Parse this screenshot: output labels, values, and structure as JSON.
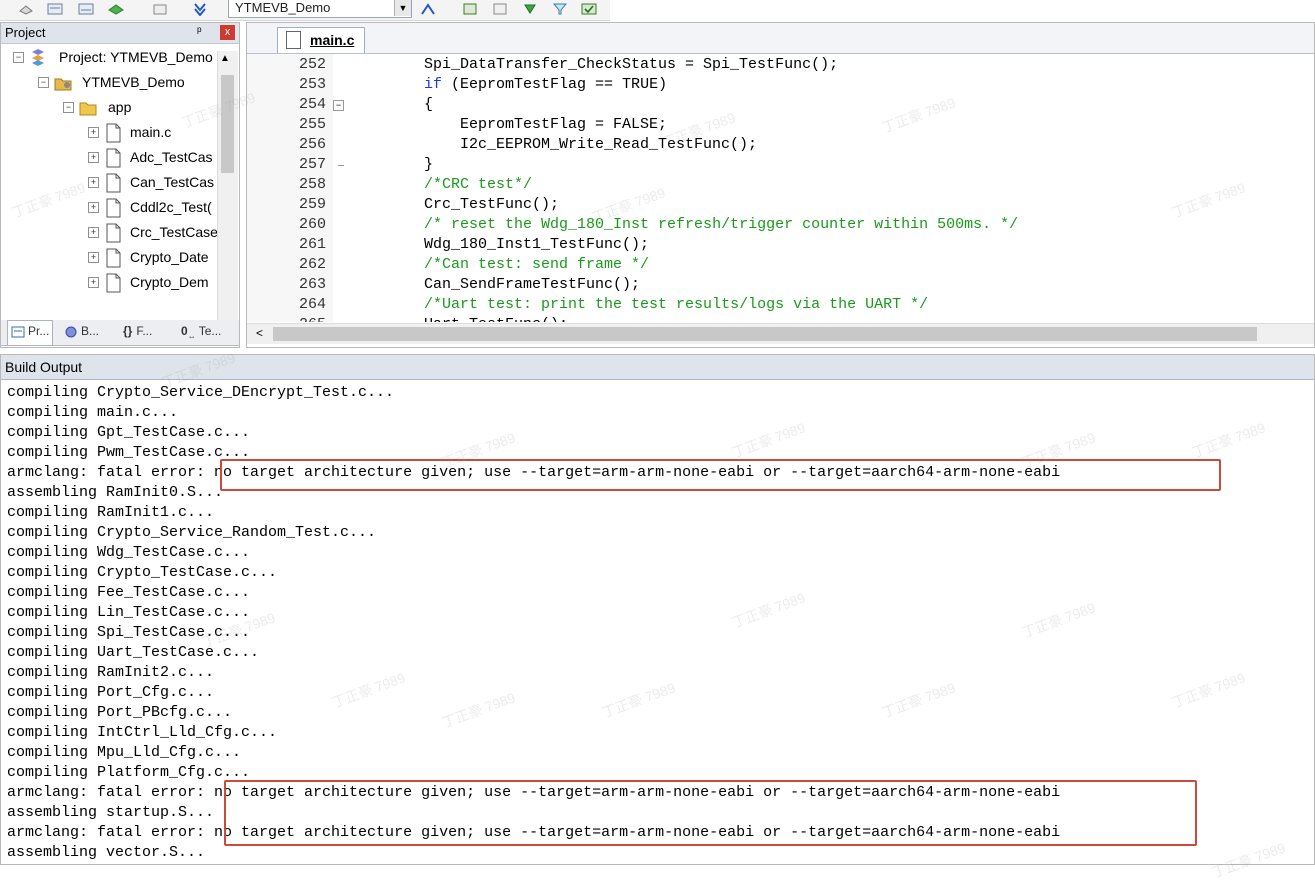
{
  "toolbar": {
    "target_value": "YTMEVB_Demo"
  },
  "project_panel": {
    "title": "Project",
    "pin_glyph": "ᵖ",
    "close_glyph": "x",
    "tree": [
      {
        "label": "Project: YTMEVB_Demo",
        "depth": 0,
        "toggle": "−",
        "icon": "project-icon"
      },
      {
        "label": "YTMEVB_Demo",
        "depth": 1,
        "toggle": "−",
        "icon": "target-folder-icon"
      },
      {
        "label": "app",
        "depth": 2,
        "toggle": "−",
        "icon": "folder-icon"
      },
      {
        "label": "main.c",
        "depth": 3,
        "toggle": "+",
        "icon": "file-icon"
      },
      {
        "label": "Adc_TestCas",
        "depth": 3,
        "toggle": "+",
        "icon": "file-icon"
      },
      {
        "label": "Can_TestCas",
        "depth": 3,
        "toggle": "+",
        "icon": "file-icon"
      },
      {
        "label": "Cddl2c_Test(",
        "depth": 3,
        "toggle": "+",
        "icon": "file-icon"
      },
      {
        "label": "Crc_TestCase",
        "depth": 3,
        "toggle": "+",
        "icon": "file-icon"
      },
      {
        "label": "Crypto_Date",
        "depth": 3,
        "toggle": "+",
        "icon": "file-icon"
      },
      {
        "label": "Crypto_Dem",
        "depth": 3,
        "toggle": "+",
        "icon": "file-icon"
      }
    ],
    "tabs": [
      {
        "label": "Pr...",
        "icon": "project-tab-icon"
      },
      {
        "label": "B...",
        "icon": "books-tab-icon"
      },
      {
        "label": "F...",
        "icon": "functions-tab-icon"
      },
      {
        "label": "Te...",
        "icon": "templates-tab-icon"
      }
    ]
  },
  "editor": {
    "tab_label": "main.c",
    "lines": [
      {
        "num": "252",
        "fold": "",
        "parts": [
          {
            "t": "    Spi_DataTransfer_CheckStatus = Spi_TestFunc();",
            "c": ""
          }
        ]
      },
      {
        "num": "253",
        "fold": "",
        "parts": [
          {
            "t": "    ",
            "c": ""
          },
          {
            "t": "if",
            "c": "kw"
          },
          {
            "t": " (EepromTestFlag == TRUE)",
            "c": ""
          }
        ]
      },
      {
        "num": "254",
        "fold": "box",
        "parts": [
          {
            "t": "    {",
            "c": ""
          }
        ]
      },
      {
        "num": "255",
        "fold": "",
        "parts": [
          {
            "t": "        EepromTestFlag = FALSE;",
            "c": ""
          }
        ]
      },
      {
        "num": "256",
        "fold": "",
        "parts": [
          {
            "t": "        I2c_EEPROM_Write_Read_TestFunc();",
            "c": ""
          }
        ]
      },
      {
        "num": "257",
        "fold": "end",
        "parts": [
          {
            "t": "    }",
            "c": ""
          }
        ]
      },
      {
        "num": "258",
        "fold": "",
        "parts": [
          {
            "t": "    ",
            "c": ""
          },
          {
            "t": "/*CRC test*/",
            "c": "cm"
          }
        ]
      },
      {
        "num": "259",
        "fold": "",
        "parts": [
          {
            "t": "    Crc_TestFunc();",
            "c": ""
          }
        ]
      },
      {
        "num": "260",
        "fold": "",
        "parts": [
          {
            "t": "    ",
            "c": ""
          },
          {
            "t": "/* reset the Wdg_180_Inst refresh/trigger counter within 500ms. */",
            "c": "cm"
          }
        ]
      },
      {
        "num": "261",
        "fold": "",
        "parts": [
          {
            "t": "    Wdg_180_Inst1_TestFunc();",
            "c": ""
          }
        ]
      },
      {
        "num": "262",
        "fold": "",
        "parts": [
          {
            "t": "    ",
            "c": ""
          },
          {
            "t": "/*Can test: send frame */",
            "c": "cm"
          }
        ]
      },
      {
        "num": "263",
        "fold": "",
        "parts": [
          {
            "t": "    Can_SendFrameTestFunc();",
            "c": ""
          }
        ]
      },
      {
        "num": "264",
        "fold": "",
        "parts": [
          {
            "t": "    ",
            "c": ""
          },
          {
            "t": "/*Uart test: print the test results/logs via the UART */",
            "c": "cm"
          }
        ]
      },
      {
        "num": "265",
        "fold": "",
        "parts": [
          {
            "t": "    Uart_TestFunc();",
            "c": ""
          }
        ]
      }
    ]
  },
  "build_output": {
    "title": "Build Output",
    "lines": [
      "compiling Crypto_Service_DEncrypt_Test.c...",
      "compiling main.c...",
      "compiling Gpt_TestCase.c...",
      "compiling Pwm_TestCase.c...",
      "armclang: fatal error: no target architecture given; use --target=arm-arm-none-eabi or --target=aarch64-arm-none-eabi",
      "assembling RamInit0.S...",
      "compiling RamInit1.c...",
      "compiling Crypto_Service_Random_Test.c...",
      "compiling Wdg_TestCase.c...",
      "compiling Crypto_TestCase.c...",
      "compiling Fee_TestCase.c...",
      "compiling Lin_TestCase.c...",
      "compiling Spi_TestCase.c...",
      "compiling Uart_TestCase.c...",
      "compiling RamInit2.c...",
      "compiling Port_Cfg.c...",
      "compiling Port_PBcfg.c...",
      "compiling IntCtrl_Lld_Cfg.c...",
      "compiling Mpu_Lld_Cfg.c...",
      "compiling Platform_Cfg.c...",
      "armclang: fatal error: no target architecture given; use --target=arm-arm-none-eabi or --target=aarch64-arm-none-eabi",
      "assembling startup.S...",
      "armclang: fatal error: no target architecture given; use --target=arm-arm-none-eabi or --target=aarch64-arm-none-eabi",
      "assembling vector.S..."
    ]
  },
  "watermark_text": "丁正豪 7989",
  "colors": {
    "keyword": "#1f3ed8",
    "comment": "#1a9a1a",
    "highlight_box": "#cc4a3a"
  }
}
